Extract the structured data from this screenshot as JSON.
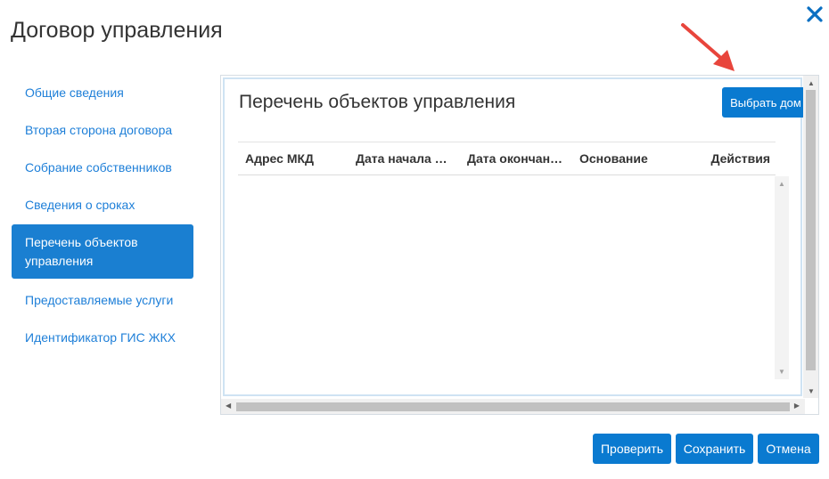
{
  "dialog": {
    "title": "Договор управления"
  },
  "nav": {
    "items": [
      {
        "label": "Общие сведения",
        "active": false
      },
      {
        "label": "Вторая сторона договора",
        "active": false
      },
      {
        "label": "Собрание собственников",
        "active": false
      },
      {
        "label": "Сведения о сроках",
        "active": false
      },
      {
        "label": "Перечень объектов управления",
        "active": true
      },
      {
        "label": "Предоставляемые услуги",
        "active": false
      },
      {
        "label": "Идентификатор ГИС ЖКХ",
        "active": false
      }
    ]
  },
  "panel": {
    "title": "Перечень объектов управления",
    "pick_button": "Выбрать дом",
    "columns": [
      "Адрес МКД",
      "Дата начала …",
      "Дата окончан…",
      "Основание",
      "Действия"
    ]
  },
  "footer": {
    "check_label": "Проверить",
    "save_label": "Сохранить",
    "cancel_label": "Отмена"
  },
  "colors": {
    "accent": "#0a7ad0",
    "link": "#1e7fd8",
    "annotation_arrow": "#e8453c"
  },
  "icons": [
    "close-icon",
    "annotation-arrow"
  ]
}
